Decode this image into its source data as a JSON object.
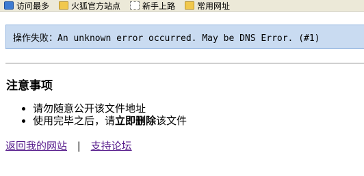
{
  "bookmarks": [
    {
      "label": "访问最多",
      "icon": "globe-icon"
    },
    {
      "label": "火狐官方站点",
      "icon": "folder-icon"
    },
    {
      "label": "新手上路",
      "icon": "page-icon"
    },
    {
      "label": "常用网址",
      "icon": "folder-icon"
    }
  ],
  "error": {
    "message": "操作失败：An unknown error occurred. May be DNS Error. (#1)"
  },
  "notice": {
    "title": "注意事项",
    "item1": "请勿随意公开该文件地址",
    "item2_prefix": "使用完毕之后，请",
    "item2_bold": "立即删除",
    "item2_suffix": "该文件"
  },
  "footer": {
    "back_link": "返回我的网站",
    "separator": "|",
    "forum_link": "支持论坛"
  }
}
